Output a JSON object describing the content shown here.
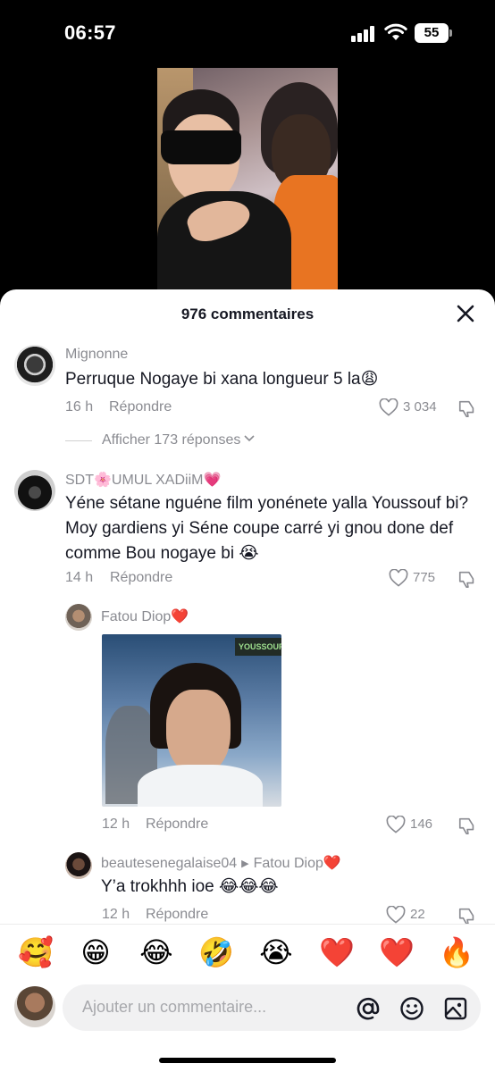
{
  "status_bar": {
    "time": "06:57",
    "battery": "55"
  },
  "sheet": {
    "title": "976 commentaires"
  },
  "comments": [
    {
      "username": "Mignonne",
      "text": "Perruque Nogaye bi xana longueur 5 la😩",
      "time": "16 h",
      "reply_label": "Répondre",
      "likes": "3 034",
      "replies_toggle": "Afficher 173 réponses"
    },
    {
      "username": "SDT🌸UMUL XADiiM💗",
      "text": "Yéne sétane nguéne film yonénete yalla Youssouf bi? Moy gardiens yi Séne coupe carré yi gnou done def comme Bou nogaye bi 😭",
      "time": "14 h",
      "reply_label": "Répondre",
      "likes": "775"
    }
  ],
  "replies": [
    {
      "username": "Fatou Diop❤️",
      "gif_watermark": "YOUSSOUF",
      "time": "12 h",
      "reply_label": "Répondre",
      "likes": "146"
    },
    {
      "username": "beautesenegalaise04",
      "reply_to": "Fatou Diop❤️",
      "text": "Y’a trokhhh ioe 😂😂😂",
      "time": "12 h",
      "reply_label": "Répondre",
      "likes": "22"
    }
  ],
  "emoji_bar": [
    "🥰",
    "😁",
    "😂",
    "🤣",
    "😭",
    "❤️",
    "❤️",
    "🔥"
  ],
  "composer": {
    "placeholder": "Ajouter un commentaire..."
  },
  "icons": [
    "signal-icon",
    "wifi-icon",
    "battery-icon",
    "close-icon",
    "heart-icon",
    "dislike-icon",
    "chevron-down-icon",
    "mention-icon",
    "emoji-icon",
    "image-icon"
  ]
}
